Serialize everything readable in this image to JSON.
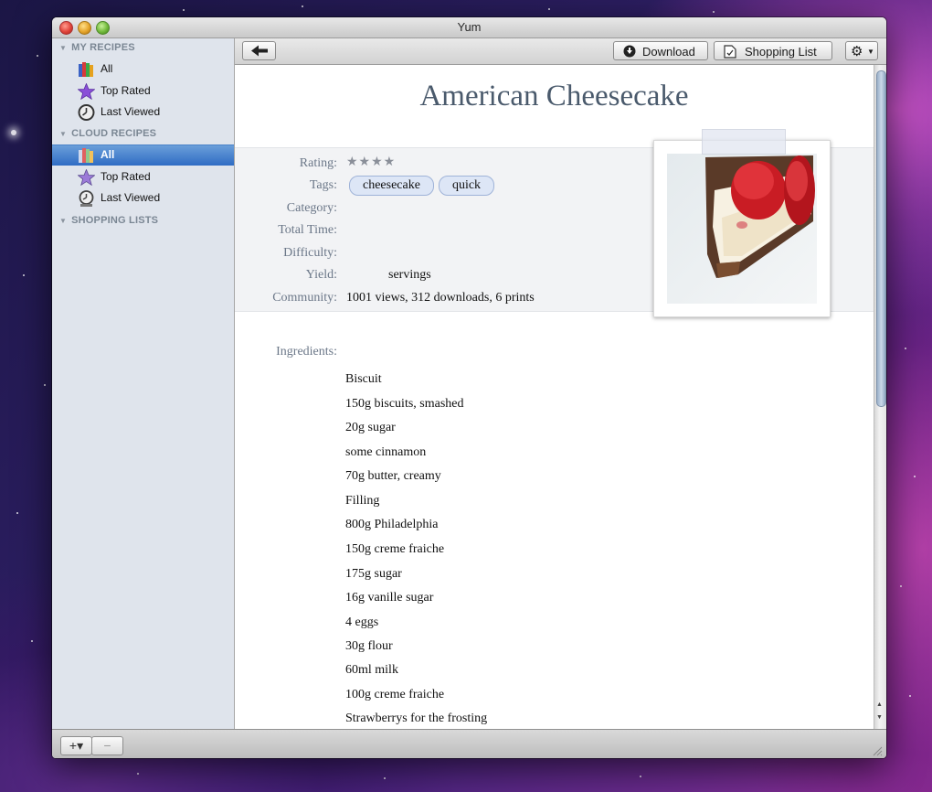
{
  "window": {
    "title": "Yum"
  },
  "sidebar": {
    "sections": [
      {
        "label": "MY RECIPES",
        "items": [
          "All",
          "Top Rated",
          "Last Viewed"
        ]
      },
      {
        "label": "CLOUD RECIPES",
        "items": [
          "All",
          "Top Rated",
          "Last Viewed"
        ]
      },
      {
        "label": "SHOPPING LISTS",
        "items": []
      }
    ],
    "selected": "CLOUD RECIPES / All"
  },
  "toolbar": {
    "back_icon": "arrow-left-icon",
    "download_label": "Download",
    "shopping_list_label": "Shopping List",
    "gear_icon": "gear-icon"
  },
  "recipe": {
    "title": "American Cheesecake",
    "rating_label": "Rating:",
    "rating_stars": "★★★★",
    "tags_label": "Tags:",
    "tags": [
      "cheesecake",
      "quick"
    ],
    "category_label": "Category:",
    "category": "",
    "total_time_label": "Total Time:",
    "total_time": "",
    "difficulty_label": "Difficulty:",
    "difficulty": "",
    "yield_label": "Yield:",
    "yield": "servings",
    "community_label": "Community:",
    "community": "1001 views, 312 downloads, 6 prints",
    "ingredients_label": "Ingredients:",
    "ingredients": [
      "Biscuit",
      "150g biscuits, smashed",
      "20g sugar",
      "some cinnamon",
      "70g butter, creamy",
      "Filling",
      "800g Philadelphia",
      "150g creme fraiche",
      "175g sugar",
      "16g vanille sugar",
      "4 eggs",
      "30g flour",
      "60ml milk",
      "100g creme fraiche",
      "Strawberrys for the frosting"
    ]
  },
  "bottom": {
    "add_label": "+▾",
    "remove_label": "−"
  },
  "colors": {
    "selection": "#2f6cc4",
    "sidebar_bg": "#dfe4ec",
    "title_text": "#4a5a6c",
    "label_text": "#6b7788"
  }
}
